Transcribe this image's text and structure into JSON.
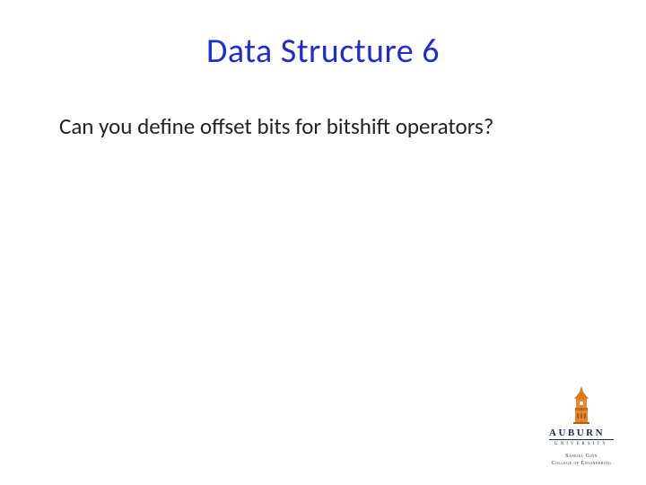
{
  "slide": {
    "title": "Data Structure 6",
    "body": "Can you define offset bits for bitshift operators?"
  },
  "logo": {
    "wordmark": "AUBURN",
    "subwordmark": "UNIVERSITY",
    "college_line1": "Samuel Ginn",
    "college_line2": "College of Engineering"
  }
}
